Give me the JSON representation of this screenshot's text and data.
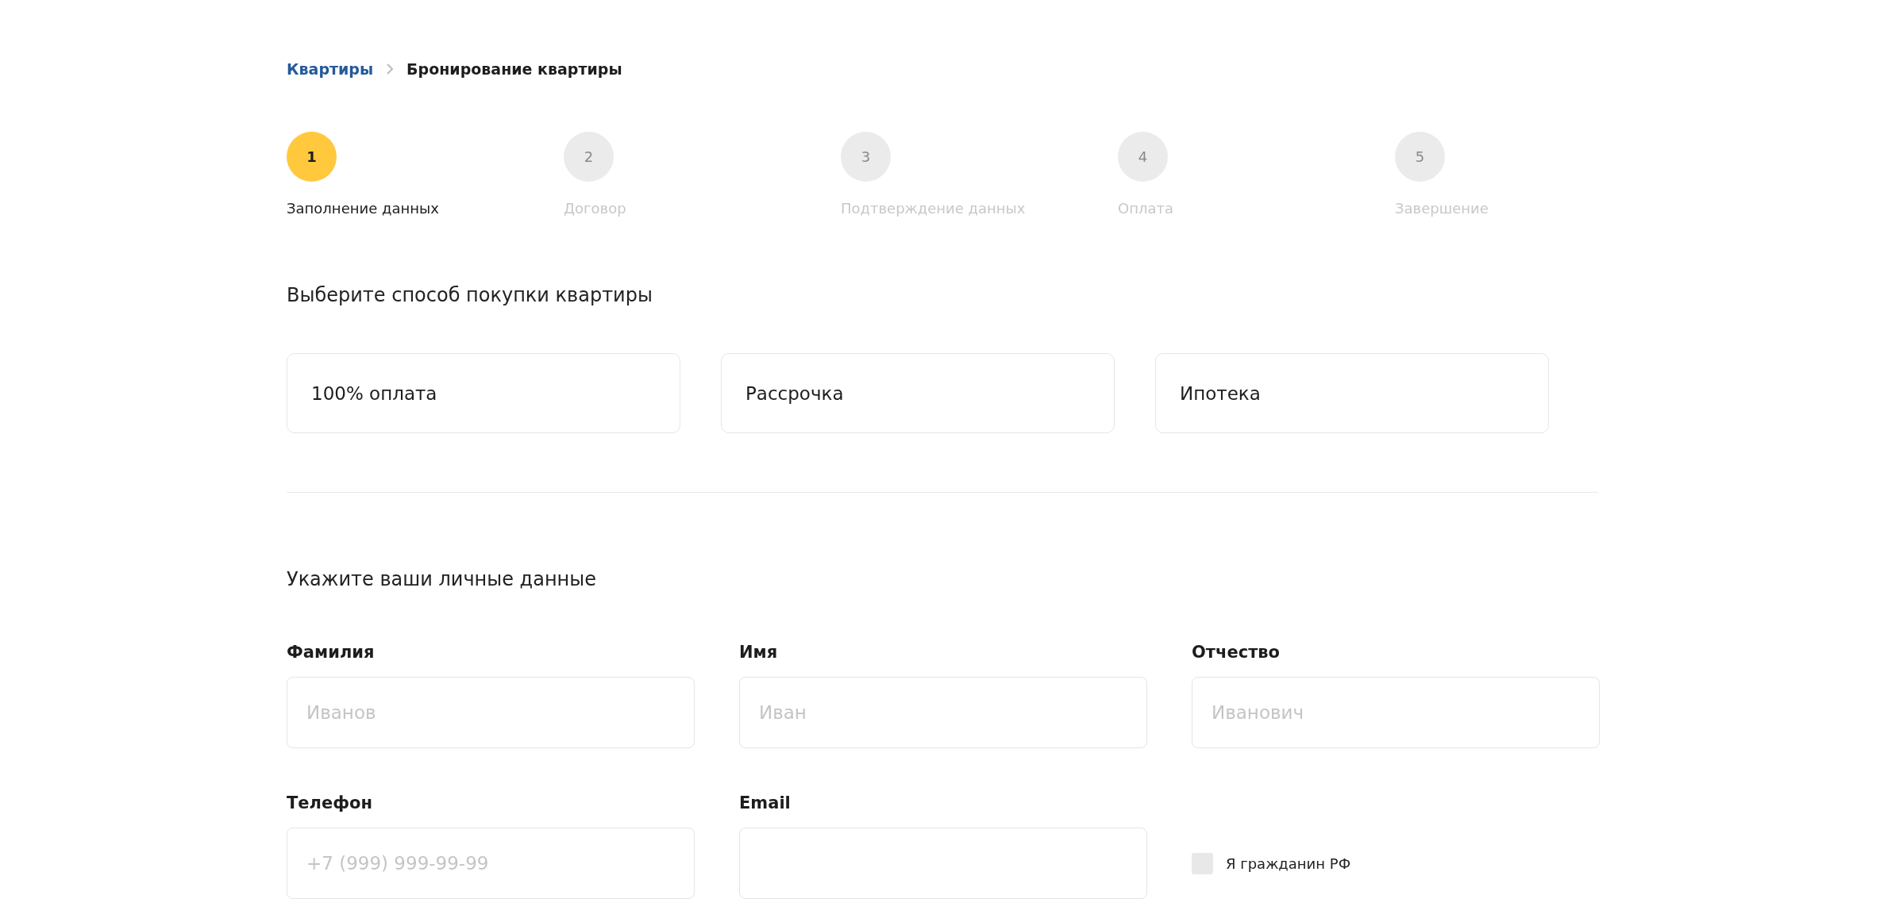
{
  "breadcrumbs": [
    {
      "label": "Квартиры",
      "kind": "link"
    },
    {
      "label": "Бронирование квартиры",
      "kind": "current"
    }
  ],
  "steps": [
    {
      "number": "1",
      "label": "Заполнение данных",
      "selected": true
    },
    {
      "number": "2",
      "label": "Договор",
      "selected": false
    },
    {
      "number": "3",
      "label": "Подтверждение данных",
      "selected": false
    },
    {
      "number": "4",
      "label": "Оплата",
      "selected": false
    },
    {
      "number": "5",
      "label": "Завершение",
      "selected": false
    }
  ],
  "purchase_section": {
    "title": "Выберите способ покупки квартиры",
    "options": [
      {
        "label": "100% оплата",
        "selected": false
      },
      {
        "label": "Рассрочка",
        "selected": false
      },
      {
        "label": "Ипотека",
        "selected": false
      }
    ]
  },
  "personal_section": {
    "title": "Укажите ваши личные данные",
    "fields": [
      {
        "kind": "input",
        "label": "Фамилия",
        "placeholder": "Иванов"
      },
      {
        "kind": "input",
        "label": "Имя",
        "placeholder": "Иван"
      },
      {
        "kind": "input",
        "label": "Отчество",
        "placeholder": "Иванович"
      },
      {
        "kind": "input",
        "label": "Телефон",
        "placeholder": "+7 (999) 999-99-99"
      },
      {
        "kind": "input",
        "label": "Email"
      },
      {
        "kind": "checkbox",
        "label": "Я гражданин РФ",
        "checked": false
      }
    ]
  }
}
